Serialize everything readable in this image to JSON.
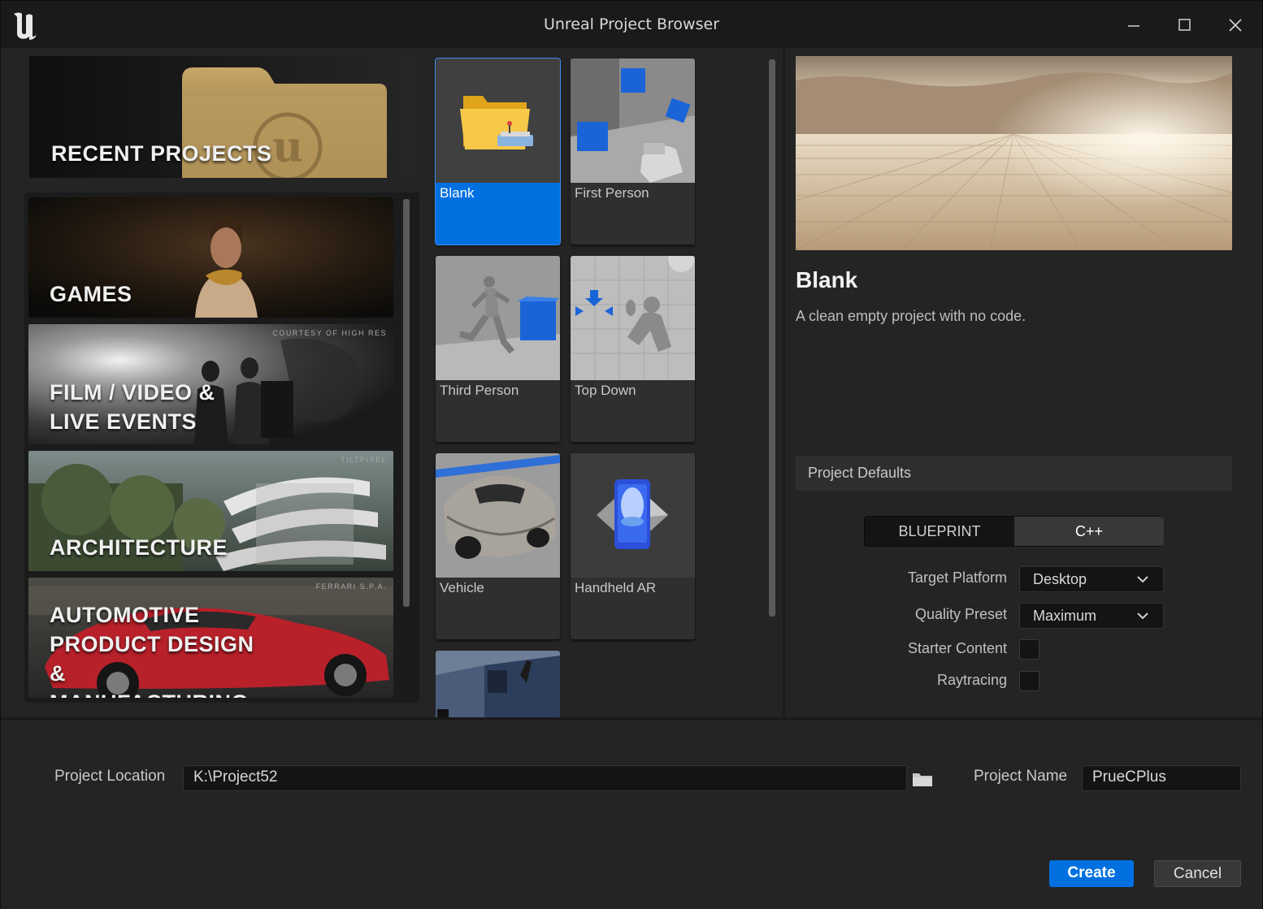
{
  "window": {
    "title": "Unreal Project Browser"
  },
  "categories": {
    "recent_label": "RECENT PROJECTS",
    "items": [
      {
        "label": "GAMES",
        "courtesy": ""
      },
      {
        "label": "FILM / VIDEO & LIVE EVENTS",
        "courtesy": "COURTESY OF HIGH RES"
      },
      {
        "label": "ARCHITECTURE",
        "courtesy": "TILTPIXEL"
      },
      {
        "label": "AUTOMOTIVE PRODUCT DESIGN & MANUFACTURING",
        "courtesy": "FERRARI S.P.A."
      }
    ],
    "selected": "GAMES"
  },
  "templates": {
    "items": [
      {
        "label": "Blank"
      },
      {
        "label": "First Person"
      },
      {
        "label": "Third Person"
      },
      {
        "label": "Top Down"
      },
      {
        "label": "Vehicle"
      },
      {
        "label": "Handheld AR"
      }
    ],
    "selected": "Blank"
  },
  "details": {
    "name": "Blank",
    "description": "A clean empty project with no code.",
    "defaults_header": "Project Defaults",
    "mode_options": [
      "BLUEPRINT",
      "C++"
    ],
    "mode_selected": "C++",
    "target_platform_label": "Target Platform",
    "target_platform_value": "Desktop",
    "quality_preset_label": "Quality Preset",
    "quality_preset_value": "Maximum",
    "starter_content_label": "Starter Content",
    "starter_content_checked": false,
    "raytracing_label": "Raytracing",
    "raytracing_checked": false
  },
  "project": {
    "location_label": "Project Location",
    "location_value": "K:\\Project52",
    "name_label": "Project Name",
    "name_value": "PrueCPlus"
  },
  "actions": {
    "create": "Create",
    "cancel": "Cancel"
  },
  "colors": {
    "accent": "#0070e0",
    "selected_outline": "#2674ce",
    "background": "#242424"
  }
}
